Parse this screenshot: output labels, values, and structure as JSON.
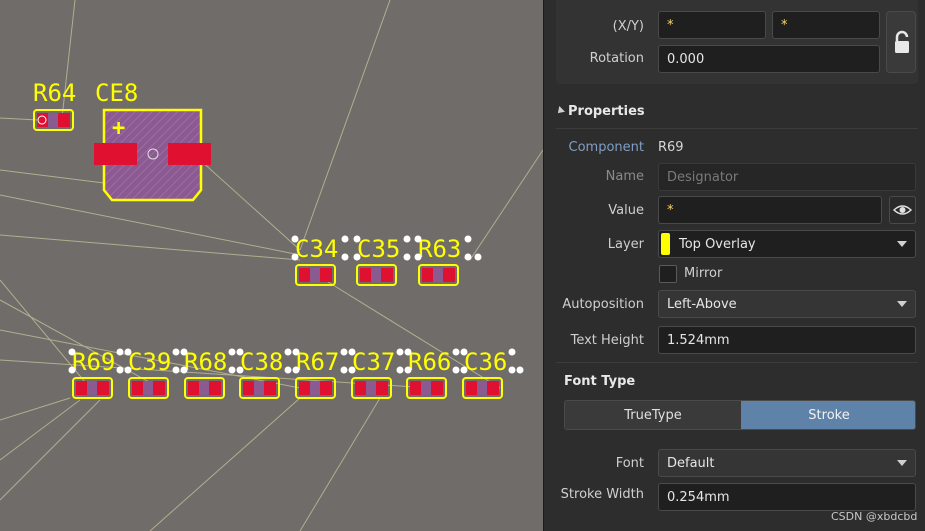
{
  "canvas": {
    "labels": {
      "r64": "R64",
      "ce8": "CE8",
      "c34": "C34",
      "c35": "C35",
      "r63": "R63",
      "r69": "R69",
      "c39": "C39",
      "r68": "R68",
      "c38": "C38",
      "r67": "R67",
      "c37": "C37",
      "r66": "R66",
      "c36": "C36"
    },
    "polarity_mark": "+"
  },
  "panel": {
    "xy": {
      "label": "(X/Y)",
      "x_value": "*",
      "y_value": "*"
    },
    "rotation": {
      "label": "Rotation",
      "value": "0.000"
    },
    "properties": {
      "title": "Properties",
      "component_label": "Component",
      "component_value": "R69",
      "name_label": "Name",
      "name_placeholder": "Designator",
      "value_label": "Value",
      "value_value": "*",
      "layer_label": "Layer",
      "layer_value": "Top Overlay",
      "mirror_label": "Mirror",
      "autoposition_label": "Autoposition",
      "autoposition_value": "Left-Above",
      "text_height_label": "Text Height",
      "text_height_value": "1.524mm"
    },
    "font_type": {
      "title": "Font Type",
      "options": [
        "TrueType",
        "Stroke"
      ],
      "selected": "Stroke",
      "font_label": "Font",
      "font_value": "Default",
      "stroke_width_label": "Stroke Width",
      "stroke_width_value": "0.254mm"
    },
    "watermark": "CSDN @xbdcbd"
  },
  "colors": {
    "canvas_bg": "#706c69",
    "silkscreen": "#ffff00",
    "pad": "#e01030",
    "body_fill": "#8a5a90",
    "selected_accent": "#5f82a8",
    "layer_swatch": "#ffff00"
  }
}
